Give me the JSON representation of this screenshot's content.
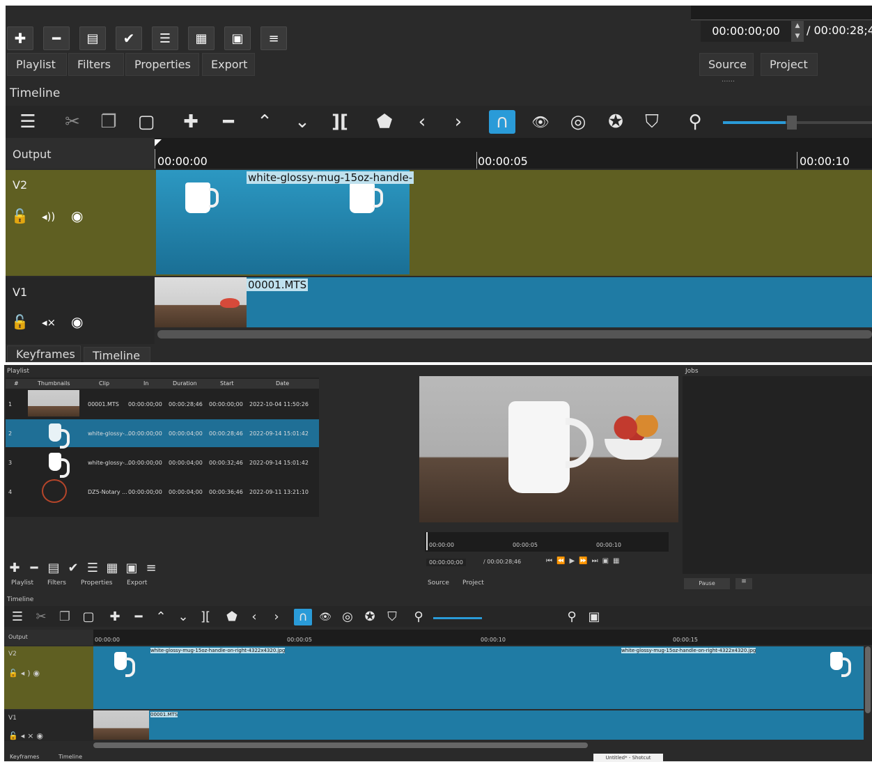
{
  "top": {
    "toolbar_icons": [
      "plus-icon",
      "minus-icon",
      "filter-list-icon",
      "check-icon",
      "list-icon",
      "grid-icon",
      "panel-icon",
      "menu-icon"
    ],
    "tabs": [
      "Playlist",
      "Filters",
      "Properties",
      "Export"
    ],
    "timecode_current": "00:00:00;00",
    "timecode_total": "/ 00:00:28;4",
    "source_tab": "Source",
    "project_tab": "Project",
    "timeline_title": "Timeline",
    "timeline_toolbar_icons": [
      "menu-icon",
      "cut-icon",
      "copy-icon",
      "paste-icon",
      "append-icon",
      "remove-icon",
      "lift-icon",
      "overwrite-icon",
      "split-icon",
      "marker-icon",
      "prev-icon",
      "next-icon",
      "snap-icon",
      "scrub-icon",
      "ripple-icon",
      "ripple-all-icon",
      "ripple-markers-icon",
      "zoom-out-icon"
    ],
    "output_label": "Output",
    "ruler": [
      "00:00:00",
      "00:00:05",
      "00:00:10"
    ],
    "tracks": [
      {
        "name": "V2",
        "clip_label": "white-glossy-mug-15oz-handle-"
      },
      {
        "name": "V1",
        "clip_label": "00001.MTS"
      }
    ],
    "bottom_tabs": [
      "Keyframes",
      "Timeline"
    ]
  },
  "bottom": {
    "playlist_title": "Playlist",
    "playlist_headers": [
      "#",
      "Thumbnails",
      "Clip",
      "In",
      "Duration",
      "Start",
      "Date"
    ],
    "playlist_rows": [
      {
        "num": "1",
        "clip": "00001.MTS",
        "in": "00:00:00;00",
        "duration": "00:00:28;46",
        "start": "00:00:00;00",
        "date": "2022-10-04 11:50:26"
      },
      {
        "num": "2",
        "clip": "white-glossy-...",
        "in": "00:00:00;00",
        "duration": "00:00:04;00",
        "start": "00:00:28;46",
        "date": "2022-09-14 15:01:42"
      },
      {
        "num": "3",
        "clip": "white-glossy-...",
        "in": "00:00:00;00",
        "duration": "00:00:04;00",
        "start": "00:00:32;46",
        "date": "2022-09-14 15:01:42"
      },
      {
        "num": "4",
        "clip": "DZ5-Notary ...",
        "in": "00:00:00;00",
        "duration": "00:00:04;00",
        "start": "00:00:36;46",
        "date": "2022-09-11 13:21:10"
      }
    ],
    "tabs": [
      "Playlist",
      "Filters",
      "Properties",
      "Export"
    ],
    "viewer_ruler": [
      "00:00:00",
      "00:00:05",
      "00:00:10"
    ],
    "viewer_timecode": "00:00:00;00",
    "viewer_total": "/ 00:00:28;46",
    "source_tab": "Source",
    "project_tab": "Project",
    "jobs_title": "Jobs",
    "pause_label": "Pause",
    "timeline_title": "Timeline",
    "output_label": "Output",
    "ruler": [
      "00:00:00",
      "00:00:05",
      "00:00:10",
      "00:00:15"
    ],
    "tracks": [
      {
        "name": "V2",
        "clip_label": "white-glossy-mug-15oz-handle-on-right-4322x4320.jpg",
        "clip_label_2": "white-glossy-mug-15oz-handle-on-right-4322x4320.jpg"
      },
      {
        "name": "V1",
        "clip_label": "00001.MTS"
      }
    ],
    "bottom_tabs": [
      "Keyframes",
      "Timeline"
    ],
    "taskbar_label": "Untitled* - Shotcut"
  },
  "colors": {
    "v2_track": "#5f5f22",
    "clip_blue": "#1f7ba4",
    "accent": "#2a9bd8",
    "panel": "#2b2b2b"
  }
}
